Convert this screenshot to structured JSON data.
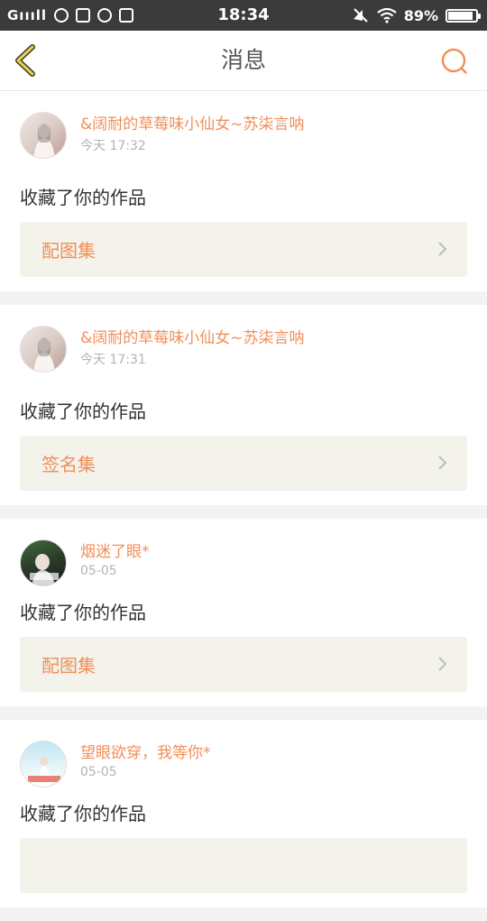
{
  "status_bar": {
    "signal": "Gıııll",
    "time": "18:34",
    "battery": "89%",
    "battery_level": 0.89
  },
  "nav": {
    "title": "消息",
    "back_icon": "chevron-left-icon",
    "search_icon": "search-icon"
  },
  "accent_color": "#f08f5a",
  "messages": [
    {
      "user": "&阔耐的草莓味小仙女~苏柒言呐",
      "time": "今天 17:32",
      "action": "收藏了你的作品",
      "work": "配图集"
    },
    {
      "user": "&阔耐的草莓味小仙女~苏柒言呐",
      "time": "今天 17:31",
      "action": "收藏了你的作品",
      "work": "签名集"
    },
    {
      "user": "烟迷了眼*",
      "time": "05-05",
      "action": "收藏了你的作品",
      "work": "配图集"
    },
    {
      "user": "望眼欲穿，我等你*",
      "time": "05-05",
      "action": "收藏了你的作品",
      "work": ""
    }
  ]
}
